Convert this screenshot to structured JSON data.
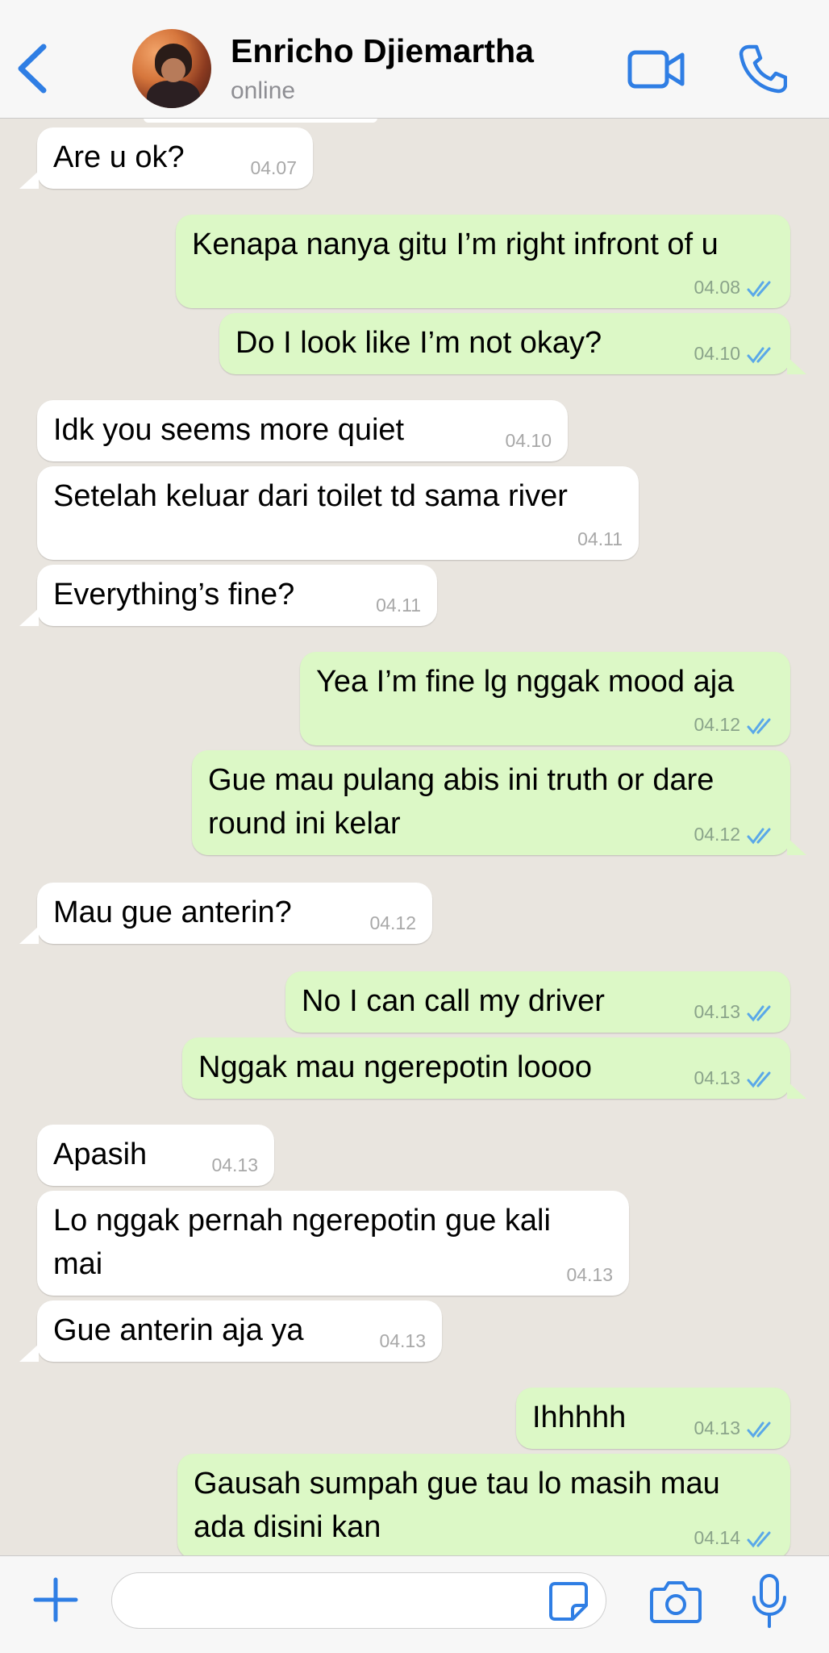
{
  "colors": {
    "accent": "#2f7ee4",
    "incoming_bubble": "#ffffff",
    "outgoing_bubble": "#dcf8c6",
    "read_ticks": "#5aa8e8",
    "background": "#e9e5df"
  },
  "header": {
    "contact_name": "Enricho Djiemartha",
    "status": "online",
    "icons": [
      "chevron-left-icon",
      "video-camera-icon",
      "phone-icon"
    ]
  },
  "messages": [
    {
      "dir": "in",
      "text": "Are u ok?",
      "time": "04.07"
    },
    {
      "dir": "out",
      "text": "Kenapa nanya gitu I’m right infront of u",
      "time": "04.08",
      "read": true
    },
    {
      "dir": "out",
      "text": "Do I look like I’m not okay?",
      "time": "04.10",
      "read": true
    },
    {
      "dir": "in",
      "text": "Idk you seems more quiet",
      "time": "04.10"
    },
    {
      "dir": "in",
      "text": "Setelah keluar dari toilet td sama river",
      "time": "04.11"
    },
    {
      "dir": "in",
      "text": "Everything’s fine?",
      "time": "04.11"
    },
    {
      "dir": "out",
      "text": "Yea I’m fine lg nggak mood aja",
      "time": "04.12",
      "read": true
    },
    {
      "dir": "out",
      "text_line1": "Gue mau pulang abis ini truth or dare",
      "text_line2": "round ini kelar",
      "time": "04.12",
      "read": true
    },
    {
      "dir": "in",
      "text": "Mau gue anterin?",
      "time": "04.12"
    },
    {
      "dir": "out",
      "text": "No I can call my driver",
      "time": "04.13",
      "read": true
    },
    {
      "dir": "out",
      "text": "Nggak mau ngerepotin loooo",
      "time": "04.13",
      "read": true
    },
    {
      "dir": "in",
      "text": "Apasih",
      "time": "04.13"
    },
    {
      "dir": "in",
      "text_line1": "Lo nggak pernah ngerepotin gue kali",
      "text_line2": "mai",
      "time": "04.13"
    },
    {
      "dir": "in",
      "text": "Gue anterin aja ya",
      "time": "04.13"
    },
    {
      "dir": "out",
      "text": "Ihhhhh",
      "time": "04.13",
      "read": true
    },
    {
      "dir": "out",
      "text_line1": "Gausah sumpah gue tau lo masih mau",
      "text_line2": "ada disini kan",
      "time": "04.14",
      "read": true
    }
  ],
  "composer": {
    "placeholder": "",
    "icons": [
      "plus-icon",
      "sticker-icon",
      "camera-icon",
      "microphone-icon"
    ]
  }
}
